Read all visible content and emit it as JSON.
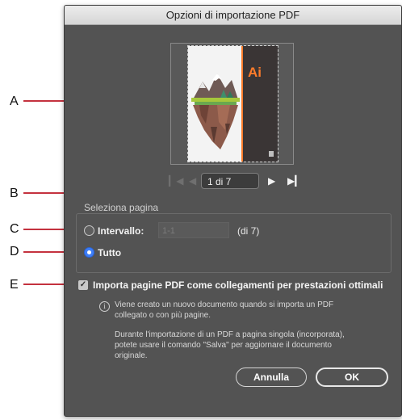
{
  "dialog": {
    "title": "Opzioni di importazione PDF"
  },
  "preview": {
    "logo_text": "Ai"
  },
  "navigation": {
    "first_icon": "first-page-icon",
    "prev_icon": "previous-page-icon",
    "page_value": "1 di 7",
    "next_icon": "next-page-icon",
    "last_icon": "last-page-icon"
  },
  "page_selection": {
    "group_title": "Seleziona pagina",
    "range_label": "Intervallo:",
    "range_placeholder": "1-1",
    "range_suffix": "(di 7)",
    "all_label": "Tutto",
    "selected": "Tutto"
  },
  "link_option": {
    "checked": true,
    "label": "Importa pagine PDF come collegamenti per prestazioni ottimali"
  },
  "info": {
    "line1": "Viene creato un nuovo documento quando si importa un PDF",
    "line2": "collegato o con più pagine.",
    "line3": "Durante l'importazione di un PDF a pagina singola (incorporata),",
    "line4": "potete usare il comando \"Salva\" per aggiornare il documento",
    "line5": "originale."
  },
  "buttons": {
    "cancel": "Annulla",
    "ok": "OK"
  },
  "callouts": {
    "a": "A",
    "b": "B",
    "c": "C",
    "d": "D",
    "e": "E"
  },
  "colors": {
    "dialog_bg": "#535353",
    "callout_line": "#c4323f",
    "radio_selected": "#3d7ef7",
    "logo_orange": "#ff7c2a"
  }
}
